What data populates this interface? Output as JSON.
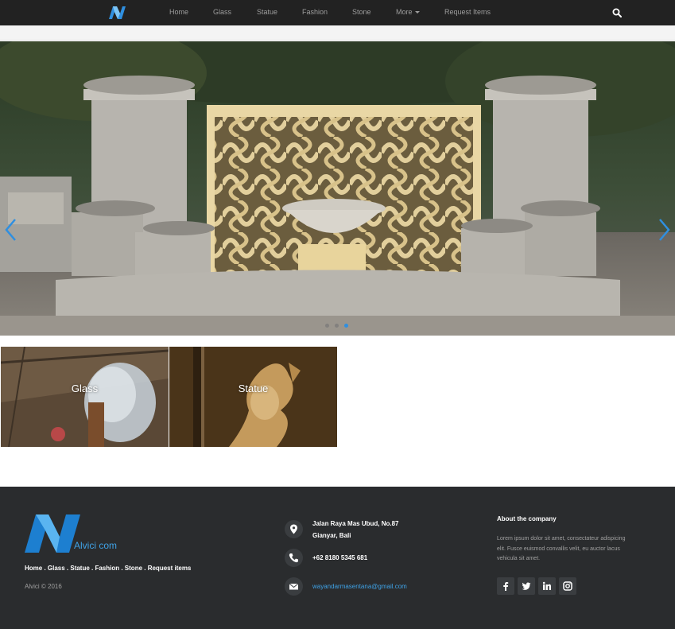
{
  "nav": {
    "links": [
      {
        "label": "Home"
      },
      {
        "label": "Glass"
      },
      {
        "label": "Statue"
      },
      {
        "label": "Fashion"
      },
      {
        "label": "Stone"
      },
      {
        "label": "More"
      },
      {
        "label": "Request Items"
      }
    ]
  },
  "carousel": {
    "slide_count": 3,
    "active_slide": 3
  },
  "tiles": [
    {
      "label": "Glass"
    },
    {
      "label": "Statue"
    }
  ],
  "footer": {
    "brand": "Alvici com",
    "nav_text": "Home . Glass . Statue . Fashion . Stone . Request items",
    "copyright": "Alvici © 2016",
    "address_line1": "Jalan Raya Mas Ubud, No.87",
    "address_line2": "Gianyar, Bali",
    "phone": "+62 8180 5345 681",
    "email": "wayandarmasentana@gmail.com",
    "about_title": "About the company",
    "about_text": "Lorem ipsum dolor sit amet, consectateur adispicing elit. Fusce euismod convallis velit, eu auctor lacus vehicula sit amet."
  },
  "colors": {
    "navbar": "#222222",
    "footer": "#2a2c2e",
    "accent": "#3fa2e6"
  }
}
